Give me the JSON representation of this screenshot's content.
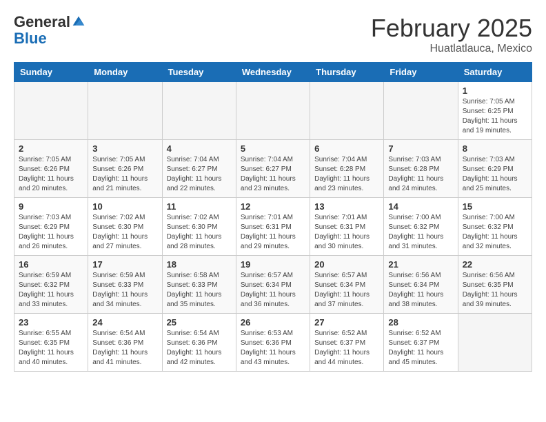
{
  "header": {
    "logo_general": "General",
    "logo_blue": "Blue",
    "month_title": "February 2025",
    "location": "Huatlatlauca, Mexico"
  },
  "days_of_week": [
    "Sunday",
    "Monday",
    "Tuesday",
    "Wednesday",
    "Thursday",
    "Friday",
    "Saturday"
  ],
  "weeks": [
    [
      {
        "day": "",
        "info": ""
      },
      {
        "day": "",
        "info": ""
      },
      {
        "day": "",
        "info": ""
      },
      {
        "day": "",
        "info": ""
      },
      {
        "day": "",
        "info": ""
      },
      {
        "day": "",
        "info": ""
      },
      {
        "day": "1",
        "info": "Sunrise: 7:05 AM\nSunset: 6:25 PM\nDaylight: 11 hours and 19 minutes."
      }
    ],
    [
      {
        "day": "2",
        "info": "Sunrise: 7:05 AM\nSunset: 6:26 PM\nDaylight: 11 hours and 20 minutes."
      },
      {
        "day": "3",
        "info": "Sunrise: 7:05 AM\nSunset: 6:26 PM\nDaylight: 11 hours and 21 minutes."
      },
      {
        "day": "4",
        "info": "Sunrise: 7:04 AM\nSunset: 6:27 PM\nDaylight: 11 hours and 22 minutes."
      },
      {
        "day": "5",
        "info": "Sunrise: 7:04 AM\nSunset: 6:27 PM\nDaylight: 11 hours and 23 minutes."
      },
      {
        "day": "6",
        "info": "Sunrise: 7:04 AM\nSunset: 6:28 PM\nDaylight: 11 hours and 23 minutes."
      },
      {
        "day": "7",
        "info": "Sunrise: 7:03 AM\nSunset: 6:28 PM\nDaylight: 11 hours and 24 minutes."
      },
      {
        "day": "8",
        "info": "Sunrise: 7:03 AM\nSunset: 6:29 PM\nDaylight: 11 hours and 25 minutes."
      }
    ],
    [
      {
        "day": "9",
        "info": "Sunrise: 7:03 AM\nSunset: 6:29 PM\nDaylight: 11 hours and 26 minutes."
      },
      {
        "day": "10",
        "info": "Sunrise: 7:02 AM\nSunset: 6:30 PM\nDaylight: 11 hours and 27 minutes."
      },
      {
        "day": "11",
        "info": "Sunrise: 7:02 AM\nSunset: 6:30 PM\nDaylight: 11 hours and 28 minutes."
      },
      {
        "day": "12",
        "info": "Sunrise: 7:01 AM\nSunset: 6:31 PM\nDaylight: 11 hours and 29 minutes."
      },
      {
        "day": "13",
        "info": "Sunrise: 7:01 AM\nSunset: 6:31 PM\nDaylight: 11 hours and 30 minutes."
      },
      {
        "day": "14",
        "info": "Sunrise: 7:00 AM\nSunset: 6:32 PM\nDaylight: 11 hours and 31 minutes."
      },
      {
        "day": "15",
        "info": "Sunrise: 7:00 AM\nSunset: 6:32 PM\nDaylight: 11 hours and 32 minutes."
      }
    ],
    [
      {
        "day": "16",
        "info": "Sunrise: 6:59 AM\nSunset: 6:32 PM\nDaylight: 11 hours and 33 minutes."
      },
      {
        "day": "17",
        "info": "Sunrise: 6:59 AM\nSunset: 6:33 PM\nDaylight: 11 hours and 34 minutes."
      },
      {
        "day": "18",
        "info": "Sunrise: 6:58 AM\nSunset: 6:33 PM\nDaylight: 11 hours and 35 minutes."
      },
      {
        "day": "19",
        "info": "Sunrise: 6:57 AM\nSunset: 6:34 PM\nDaylight: 11 hours and 36 minutes."
      },
      {
        "day": "20",
        "info": "Sunrise: 6:57 AM\nSunset: 6:34 PM\nDaylight: 11 hours and 37 minutes."
      },
      {
        "day": "21",
        "info": "Sunrise: 6:56 AM\nSunset: 6:34 PM\nDaylight: 11 hours and 38 minutes."
      },
      {
        "day": "22",
        "info": "Sunrise: 6:56 AM\nSunset: 6:35 PM\nDaylight: 11 hours and 39 minutes."
      }
    ],
    [
      {
        "day": "23",
        "info": "Sunrise: 6:55 AM\nSunset: 6:35 PM\nDaylight: 11 hours and 40 minutes."
      },
      {
        "day": "24",
        "info": "Sunrise: 6:54 AM\nSunset: 6:36 PM\nDaylight: 11 hours and 41 minutes."
      },
      {
        "day": "25",
        "info": "Sunrise: 6:54 AM\nSunset: 6:36 PM\nDaylight: 11 hours and 42 minutes."
      },
      {
        "day": "26",
        "info": "Sunrise: 6:53 AM\nSunset: 6:36 PM\nDaylight: 11 hours and 43 minutes."
      },
      {
        "day": "27",
        "info": "Sunrise: 6:52 AM\nSunset: 6:37 PM\nDaylight: 11 hours and 44 minutes."
      },
      {
        "day": "28",
        "info": "Sunrise: 6:52 AM\nSunset: 6:37 PM\nDaylight: 11 hours and 45 minutes."
      },
      {
        "day": "",
        "info": ""
      }
    ]
  ]
}
